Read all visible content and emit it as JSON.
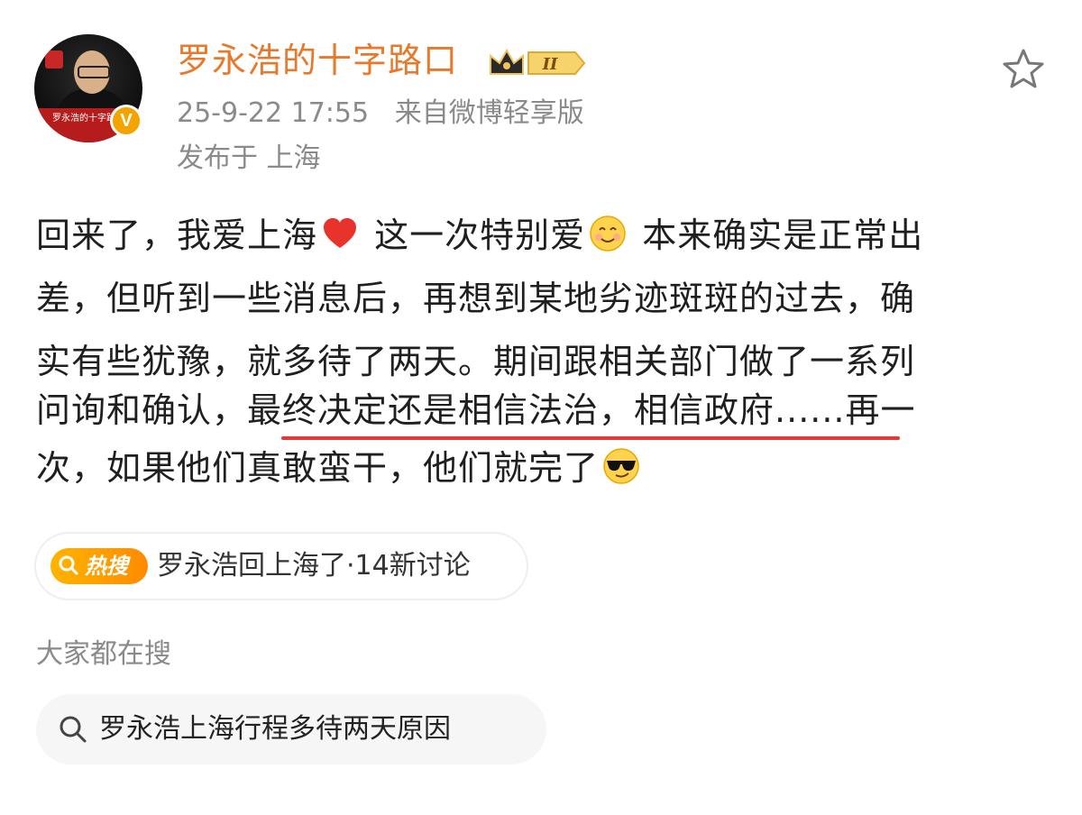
{
  "header": {
    "username": "罗永浩的十字路口",
    "avatar_banner": "罗永浩的十字路口",
    "level_badge": "II",
    "timestamp": "25-9-22 17:55",
    "source": "来自微博轻享版",
    "location": "发布于 上海",
    "verified_mark": "V"
  },
  "post": {
    "line1_a": "回来了，我爱上海",
    "line1_b": " 这一次特别爱",
    "line1_c": " 本来确实是正常出",
    "line2": "差，但听到一些消息后，再想到某地劣迹斑斑的过去，确",
    "line3": "实有些犹豫，就多待了两天。期间跟相关部门做了一系列",
    "line4_a": "问询和确认，",
    "line4_b": "最终决定还是相信法治，相信政府",
    "line4_c": "......再一",
    "line5": "次，如果他们真敢蛮干，他们就完了"
  },
  "hot_search": {
    "tag": "热搜",
    "text": "罗永浩回上海了·14新讨论"
  },
  "everyone_search": {
    "label": "大家都在搜",
    "query": "罗永浩上海行程多待两天原因"
  },
  "colors": {
    "username": "#e9792a",
    "meta": "#8a8a8a",
    "underline": "#e53935",
    "hot_tag": "#ff9f00"
  }
}
